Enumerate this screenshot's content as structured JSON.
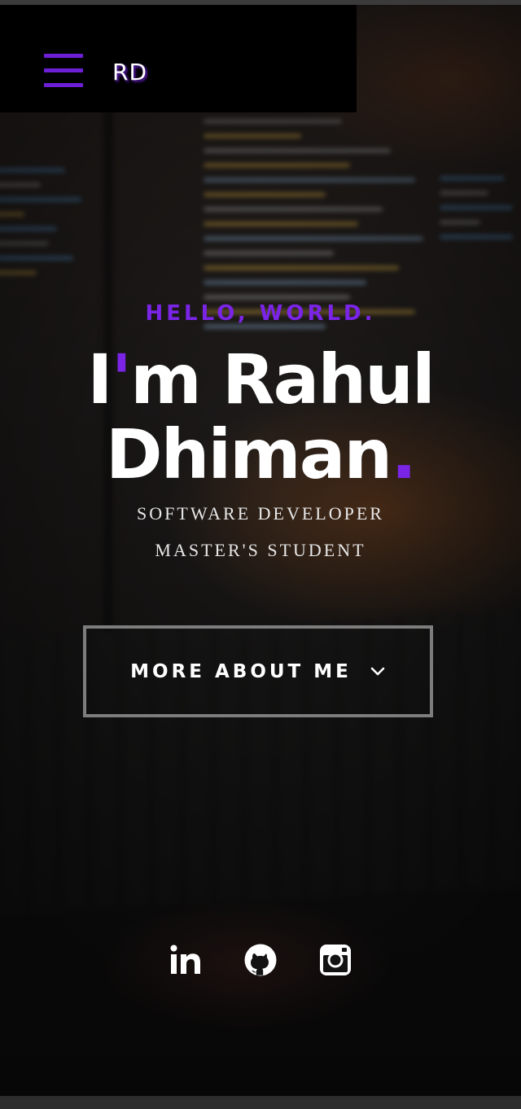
{
  "nav": {
    "logo": "RD",
    "menu_icon": "hamburger-menu-icon"
  },
  "hero": {
    "greeting": "HELLO, WORLD.",
    "name_line1_prefix": "I",
    "name_line1_apostrophe": "'",
    "name_line1_suffix": "m Rahul",
    "name_line2": "Dhiman",
    "name_dot": ".",
    "roles": [
      "SOFTWARE DEVELOPER",
      "MASTER'S STUDENT"
    ],
    "cta_label": "MORE ABOUT ME",
    "cta_icon": "chevron-down-icon"
  },
  "socials": [
    {
      "icon": "linkedin-icon"
    },
    {
      "icon": "github-icon"
    },
    {
      "icon": "instagram-icon"
    }
  ],
  "colors": {
    "accent": "#7a24e6",
    "nav_bg": "#000000",
    "text": "#ffffff"
  }
}
